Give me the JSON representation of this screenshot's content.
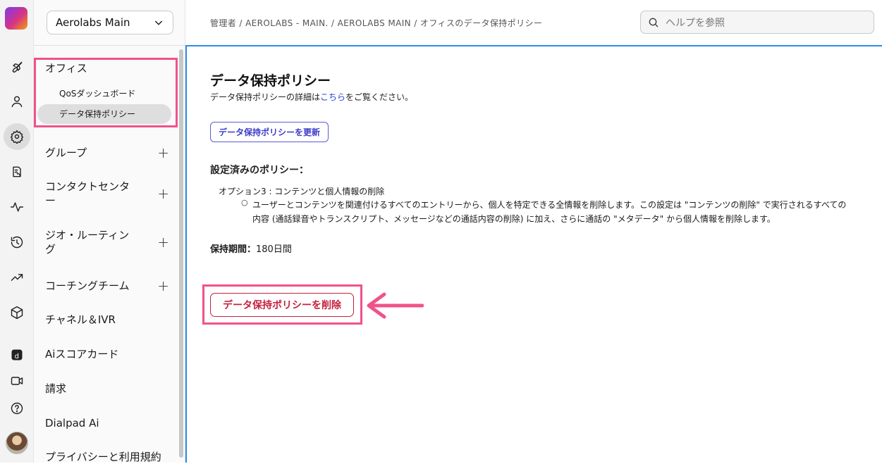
{
  "breadcrumb": "管理者 / AEROLABS - MAIN. / AEROLABS MAIN / オフィスのデータ保持ポリシー",
  "search": {
    "placeholder": "ヘルプを参照"
  },
  "org_selector": {
    "value": "Aerolabs Main"
  },
  "sidebar": {
    "office": {
      "label": "オフィス",
      "items": [
        "QoSダッシュボード",
        "データ保持ポリシー"
      ]
    },
    "items": [
      {
        "label": "グループ",
        "expandable": true
      },
      {
        "label": "コンタクトセンター",
        "expandable": true
      },
      {
        "label": "ジオ・ルーティング",
        "expandable": true
      },
      {
        "label": "コーチングチーム",
        "expandable": true
      },
      {
        "label": "チャネル＆IVR",
        "expandable": false
      },
      {
        "label": "Aiスコアカード",
        "expandable": false
      },
      {
        "label": "請求",
        "expandable": false
      },
      {
        "label": "Dialpad Ai",
        "expandable": false
      },
      {
        "label": "プライバシーと利用規約",
        "expandable": false
      }
    ]
  },
  "main": {
    "title": "データ保持ポリシー",
    "subtitle_prefix": "データ保持ポリシーの詳細は",
    "subtitle_link": "こちら",
    "subtitle_suffix": "をご覧ください。",
    "update_button": "データ保持ポリシーを更新",
    "configured_heading": "設定済みのポリシー：",
    "option_title": "オプション3 : コンテンツと個人情報の削除",
    "option_description": "ユーザーとコンテンツを関連付けるすべてのエントリーから、個人を特定できる全情報を削除します。この設定は \"コンテンツの削除\" で実行されるすべての内容 (通話録音やトランスクリプト、メッセージなどの通話内容の削除) に加え、さらに通話の \"メタデータ\" から個人情報を削除します。",
    "retention_label": "保持期間：",
    "retention_value": "180日間",
    "delete_button": "データ保持ポリシーを削除"
  },
  "colors": {
    "highlight": "#f0528a",
    "danger": "#c4203d",
    "accent": "#5b5bd6",
    "link": "#2343d6"
  }
}
